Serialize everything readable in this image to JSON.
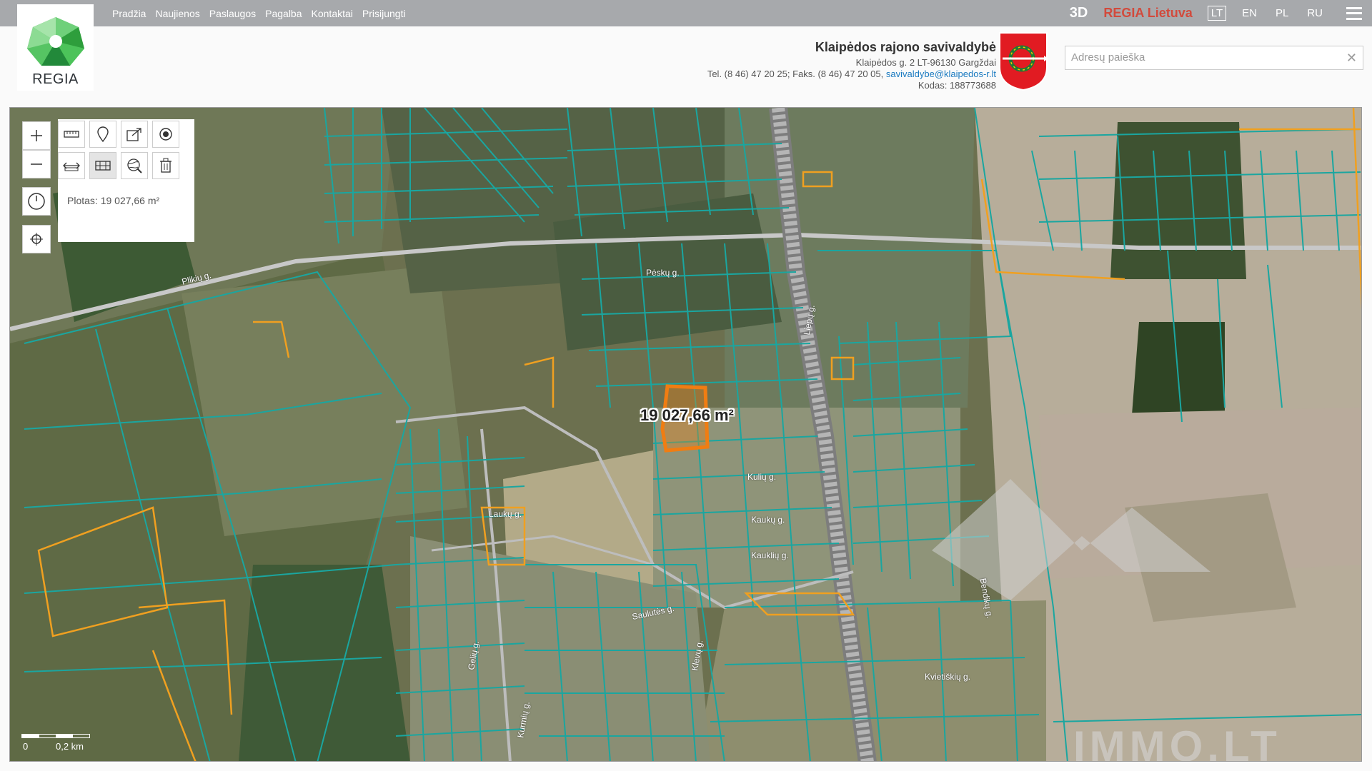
{
  "nav": {
    "items": [
      "Pradžia",
      "Naujienos",
      "Paslaugos",
      "Pagalba",
      "Kontaktai",
      "Prisijungti"
    ]
  },
  "top_right": {
    "btn_3d": "3D",
    "regia_lietuva": "REGIA Lietuva",
    "languages": [
      "LT",
      "EN",
      "PL",
      "RU"
    ],
    "active_language": "LT"
  },
  "logo": {
    "text": "REGIA"
  },
  "municipality": {
    "name": "Klaipėdos rajono savivaldybė",
    "address": "Klaipėdos g. 2 LT-96130 Gargždai",
    "phone": "Tel. (8 46) 47 20 25; Faks. (8 46) 47 20 05,",
    "email": "savivaldybe@klaipedos-r.lt",
    "code": "Kodas: 188773688"
  },
  "search": {
    "placeholder": "Adresų paieška",
    "value": ""
  },
  "map": {
    "area_panel_text": "Plotas: 19 027,66 m²",
    "area_label": "19 027,66 m²",
    "scale": {
      "start": "0",
      "end": "0,2 km"
    },
    "road_labels": [
      "Plikių g.",
      "Pėskų g.",
      "Kulių g.",
      "Kaukų g.",
      "Kauklių g.",
      "Laukų g.",
      "Saulutės g.",
      "Bendikų g.",
      "Kvietiškių g.",
      "Gelių g.",
      "Liepų g.",
      "Kurmių g.",
      "Klevų g."
    ],
    "watermark": "IMMO.LT",
    "colors": {
      "parcel_line": "#1aa6a0",
      "highlight_parcel": "#f07d12",
      "orange_parcels": "#f0a020",
      "road": "#c8c8c8"
    }
  },
  "icons": {
    "zoom_in": "plus-icon",
    "zoom_out": "minus-icon",
    "history": "clock-icon",
    "locate": "crosshair-icon",
    "measure": "ruler-icon",
    "marker": "pin-icon",
    "share": "share-icon",
    "point": "radio-icon",
    "measure_line": "line-measure-icon",
    "measure_area": "area-measure-icon",
    "search_area": "globe-search-icon",
    "delete": "trash-icon"
  }
}
